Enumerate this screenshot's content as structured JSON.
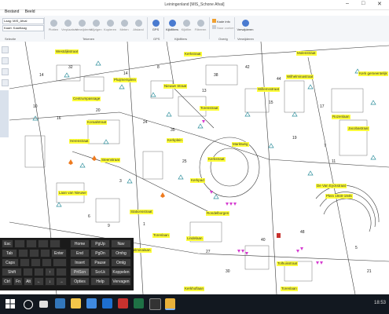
{
  "window": {
    "title": "Leiningenland [MIS_Schone Afval]",
    "controls": [
      "–",
      "□",
      "✕"
    ]
  },
  "menu": {
    "tabs": [
      "Bestand",
      "Beeld"
    ]
  },
  "ribbon": {
    "buttons": [
      "Plotten",
      "Verplaatsen",
      "Verwijderen",
      "Wijzigen",
      "Kopieren",
      "Meten",
      "Afstand",
      "GPS",
      "Kijkfilters",
      "Kijkfilm",
      "Filtreren",
      "Kade info",
      "Naar zoeken",
      "Verwijderen"
    ],
    "groups": [
      "Selectie",
      "Tekenen",
      "GPS",
      "Kijkfilters",
      "Overig",
      "Verwijderen"
    ],
    "layer_dropdown_1": "Laag: MIS_Afval",
    "layer_dropdown_2": "Kaart: Kaartlaag"
  },
  "map": {
    "street_labels": [
      "Westdijkstraat",
      "Pluijmersplein",
      "Kerkstraat",
      "Nieuwe Straat",
      "Wilhelminastraat",
      "Kerk gemeentelijk",
      "Willemsstraat",
      "Centrumpassage",
      "Steenstraat",
      "Molenstraat",
      "Kerkplein",
      "Herenstraat",
      "Torenstraat",
      "Laan van Nieuwe",
      "Stationsstraat",
      "Kerkpad",
      "Jacobastraat",
      "Marktweg",
      "Torenlaan",
      "Wilhelminalaan",
      "De Van Eyckstraat",
      "Kerkstraat",
      "Plein 1940-1945",
      "Rondelborgen",
      "Tolhuisstraat",
      "Torenlaan",
      "Kerkhoflaan",
      "Lindelaan",
      "Koraalstraat",
      "Rozenlaan"
    ],
    "house_numbers": [
      "14",
      "32",
      "14",
      "8",
      "10",
      "16",
      "20",
      "35",
      "24",
      "38",
      "42",
      "44",
      "17",
      "7",
      "11",
      "25",
      "3",
      "6",
      "9",
      "1",
      "27",
      "30",
      "40",
      "48",
      "5",
      "21",
      "34",
      "13",
      "15",
      "19"
    ]
  },
  "keyboard": {
    "keys": [
      "Esc",
      "Tab",
      "Caps",
      "Shift",
      "Ctrl",
      "Fn",
      "Alt",
      "Enter",
      "Home",
      "PgUp",
      "Nav",
      "End",
      "PgDn",
      "Omhg",
      "Insert",
      "Pause",
      "Omlg",
      "PrtScn",
      "ScrLk",
      "Koppelen",
      "Opties",
      "Help",
      "Vervagen",
      "↑",
      "←",
      "↓",
      "→"
    ]
  },
  "taskbar": {
    "time": "18:53",
    "icons": [
      "search-icon",
      "task-view-icon",
      "edge-icon",
      "explorer-icon",
      "store-icon",
      "mail-icon",
      "app-red-icon",
      "app-excel-icon",
      "app-black-icon",
      "app-chrome-icon"
    ],
    "colors": {
      "search": "#ffffff",
      "task": "#e0e0e0",
      "edge": "#3277bc",
      "explorer": "#f3c54a",
      "store": "#3f8ae0",
      "mail": "#1e6fd0",
      "red": "#c8322e",
      "excel": "#1e7145",
      "black": "#333333",
      "chrome": "#e8b13a"
    }
  }
}
